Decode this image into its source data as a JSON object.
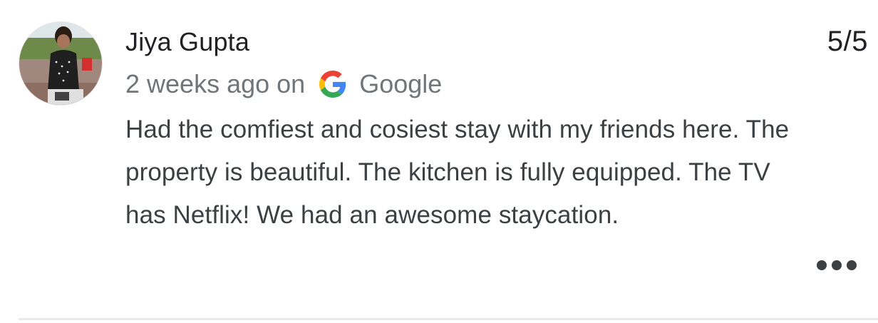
{
  "review": {
    "author_name": "Jiya Gupta",
    "time_ago": "2 weeks ago on",
    "source": "Google",
    "source_icon": "google-g-icon",
    "rating": "5/5",
    "text": "Had the comfiest and cosiest stay with my friends here. The property is beautiful. The kitchen is fully equipped. The TV has Netflix! We had an awesome staycation.",
    "more_icon": "more-horizontal-icon"
  },
  "colors": {
    "name": "#202124",
    "meta": "#70757a",
    "body": "#3c4043",
    "divider": "#e8eaed",
    "google_blue": "#4285F4",
    "google_red": "#EA4335",
    "google_yellow": "#FBBC05",
    "google_green": "#34A853"
  }
}
